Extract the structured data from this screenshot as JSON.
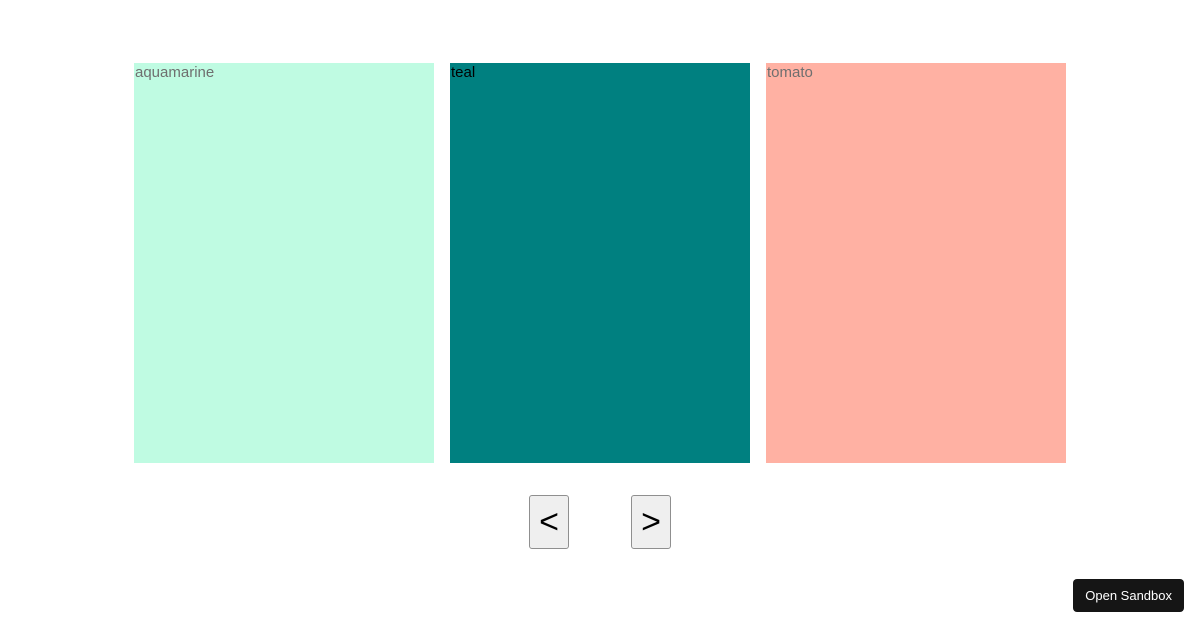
{
  "slides": [
    {
      "label": "aquamarine",
      "color": "#bffbe2",
      "labelDark": false
    },
    {
      "label": "teal",
      "color": "#008080",
      "labelDark": true
    },
    {
      "label": "tomato",
      "color": "#ffb1a3",
      "labelDark": false
    }
  ],
  "controls": {
    "prev": "<",
    "next": ">"
  },
  "sandbox": {
    "open_label": "Open Sandbox"
  }
}
